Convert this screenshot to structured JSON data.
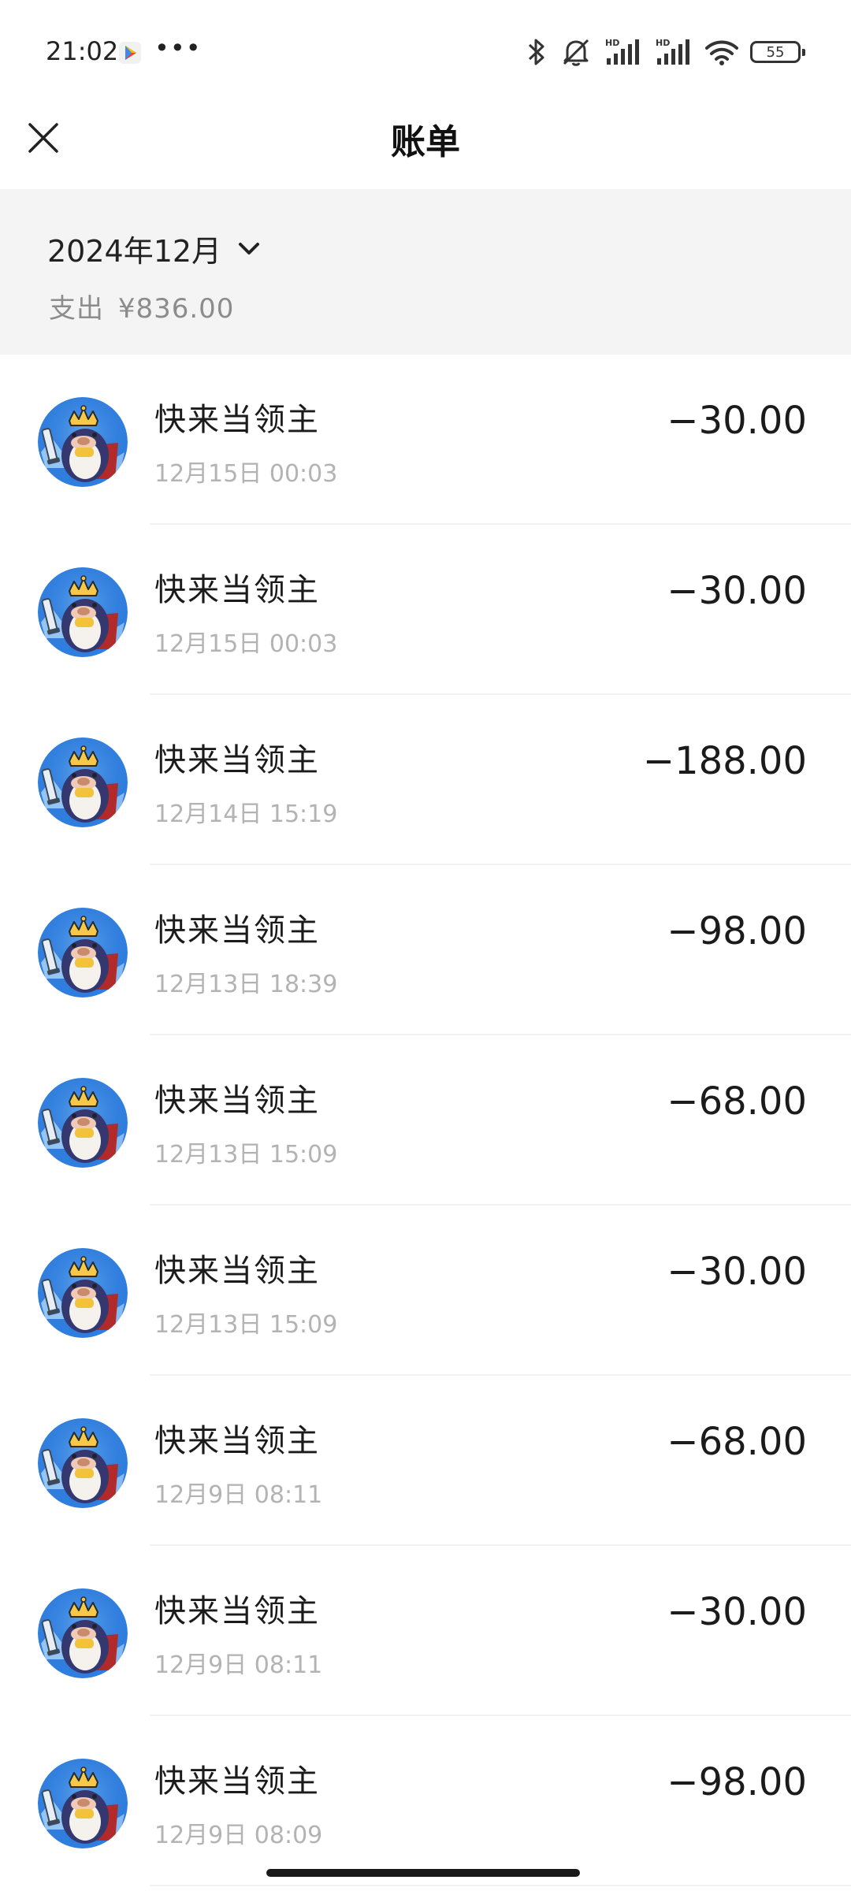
{
  "status_bar": {
    "time": "21:02",
    "more": "•••",
    "battery": "55"
  },
  "header": {
    "title": "账单"
  },
  "summary": {
    "month": "2024年12月",
    "expense_label": "支出",
    "expense_amount": "¥836.00"
  },
  "transactions": [
    {
      "name": "快来当领主",
      "time": "12月15日  00:03",
      "amount": "−30.00"
    },
    {
      "name": "快来当领主",
      "time": "12月15日  00:03",
      "amount": "−30.00"
    },
    {
      "name": "快来当领主",
      "time": "12月14日  15:19",
      "amount": "−188.00"
    },
    {
      "name": "快来当领主",
      "time": "12月13日  18:39",
      "amount": "−98.00"
    },
    {
      "name": "快来当领主",
      "time": "12月13日  15:09",
      "amount": "−68.00"
    },
    {
      "name": "快来当领主",
      "time": "12月13日  15:09",
      "amount": "−30.00"
    },
    {
      "name": "快来当领主",
      "time": "12月9日  08:11",
      "amount": "−68.00"
    },
    {
      "name": "快来当领主",
      "time": "12月9日  08:11",
      "amount": "−30.00"
    },
    {
      "name": "快来当领主",
      "time": "12月9日  08:09",
      "amount": "−98.00"
    }
  ],
  "icons": {
    "close": "close-icon",
    "chevron": "chevron-down-icon",
    "avatar": "penguin-king-avatar"
  },
  "colors": {
    "summary_bg": "#f4f4f4",
    "secondary_text": "#8c8c8c",
    "time_text": "#b3b3b3"
  }
}
